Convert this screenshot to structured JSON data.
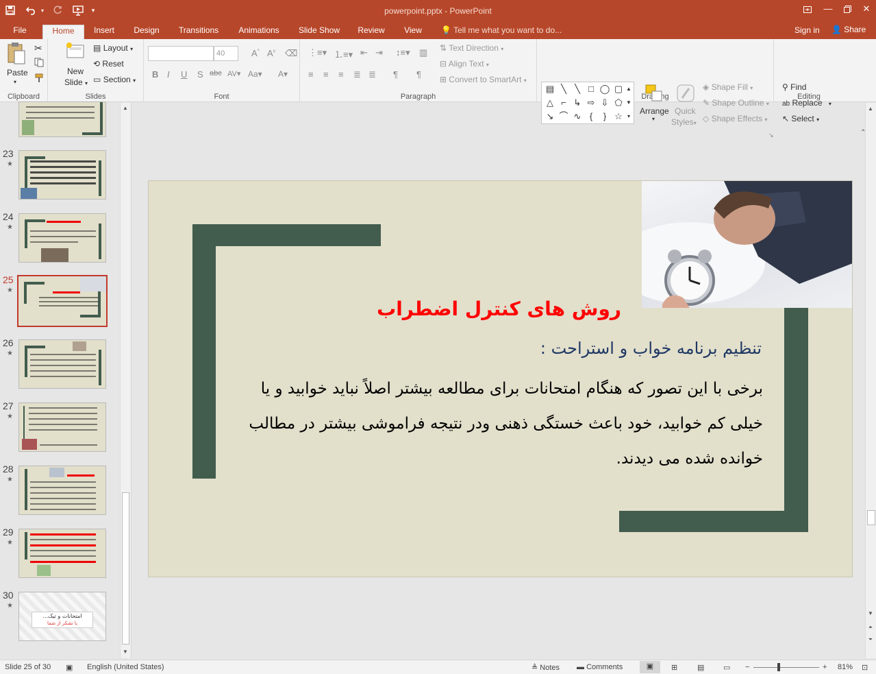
{
  "window": {
    "title": "powerpoint.pptx - PowerPoint",
    "controls": [
      "restore-ribbon",
      "minimize",
      "restore",
      "close"
    ]
  },
  "quick_access": [
    "save-icon",
    "undo-icon",
    "redo-icon",
    "start-from-beginning-icon",
    "customize-icon"
  ],
  "tabs": [
    {
      "label": "File"
    },
    {
      "label": "Home",
      "active": true
    },
    {
      "label": "Insert"
    },
    {
      "label": "Design"
    },
    {
      "label": "Transitions"
    },
    {
      "label": "Animations"
    },
    {
      "label": "Slide Show"
    },
    {
      "label": "Review"
    },
    {
      "label": "View"
    }
  ],
  "tell_me": "Tell me what you want to do...",
  "account": {
    "sign_in": "Sign in",
    "share": "Share"
  },
  "ribbon": {
    "clipboard": {
      "label": "Clipboard",
      "paste": "Paste"
    },
    "slides": {
      "label": "Slides",
      "new_slide_1": "New",
      "new_slide_2": "Slide",
      "layout": "Layout",
      "reset": "Reset",
      "section": "Section"
    },
    "font": {
      "label": "Font",
      "font_name": "",
      "font_size": "40"
    },
    "paragraph": {
      "label": "Paragraph",
      "text_direction": "Text Direction",
      "align_text": "Align Text",
      "convert_smartart": "Convert to SmartArt"
    },
    "drawing": {
      "label": "Drawing",
      "arrange": "Arrange",
      "quick_styles_1": "Quick",
      "quick_styles_2": "Styles",
      "shape_fill": "Shape Fill",
      "shape_outline": "Shape Outline",
      "shape_effects": "Shape Effects"
    },
    "editing": {
      "label": "Editing",
      "find": "Find",
      "replace": "Replace",
      "select": "Select"
    }
  },
  "thumbnails": [
    {
      "num": "23",
      "star": "★"
    },
    {
      "num": "24",
      "star": "★"
    },
    {
      "num": "25",
      "star": "★",
      "selected": true
    },
    {
      "num": "26",
      "star": "★"
    },
    {
      "num": "27",
      "star": "★"
    },
    {
      "num": "28",
      "star": "★"
    },
    {
      "num": "29",
      "star": "★"
    },
    {
      "num": "30",
      "star": "★"
    }
  ],
  "slide": {
    "title": "روش های کنترل اضطراب",
    "subtitle": "تنظیم برنامه خواب و استراحت :",
    "body": "برخی با این تصور که هنگام امتحانات برای مطالعه بیشتر اصلاً نباید خوابید و یا خیلی کم خوابید، خود باعث خستگی ذهنی ودر نتیجه فراموشی بیشتر در مطالب خوانده شده می دیدند.",
    "colors": {
      "background": "#e2dfcb",
      "bars": "#425c4d",
      "title": "#ff0000",
      "subtitle": "#1f3864"
    }
  },
  "thumb_text": {
    "t30_title": "امتحانات و تیک...",
    "t30_sub": "با تشکر از شما"
  },
  "status": {
    "slide_info": "Slide 25 of 30",
    "language": "English (United States)",
    "notes": "Notes",
    "comments": "Comments",
    "zoom_minus": "−",
    "zoom_plus": "+",
    "zoom": "81%"
  },
  "theme": {
    "accent": "#b7472a"
  }
}
